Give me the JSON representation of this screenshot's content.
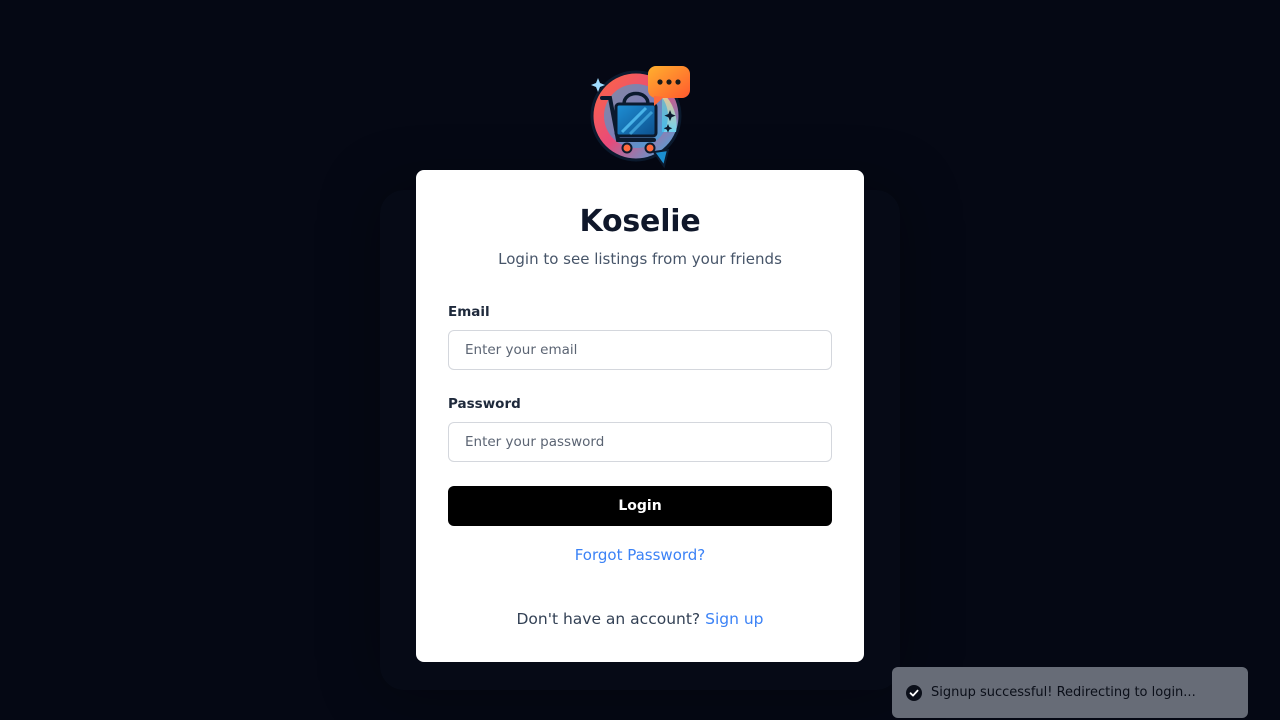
{
  "app": {
    "name": "Koselie",
    "subtitle": "Login to see listings from your friends"
  },
  "form": {
    "email_label": "Email",
    "email_placeholder": "Enter your email",
    "email_value": "",
    "password_label": "Password",
    "password_placeholder": "Enter your password",
    "password_value": "",
    "login_label": "Login",
    "forgot_label": "Forgot Password?",
    "signup_prompt": "Don't have an account?",
    "signup_label": "Sign up"
  },
  "toast": {
    "icon": "check-circle-icon",
    "message": "Signup successful! Redirecting to login..."
  },
  "colors": {
    "background": "#050814",
    "card": "#ffffff",
    "primary_button": "#000000",
    "link": "#3b82f6",
    "toast": "#676c77"
  }
}
